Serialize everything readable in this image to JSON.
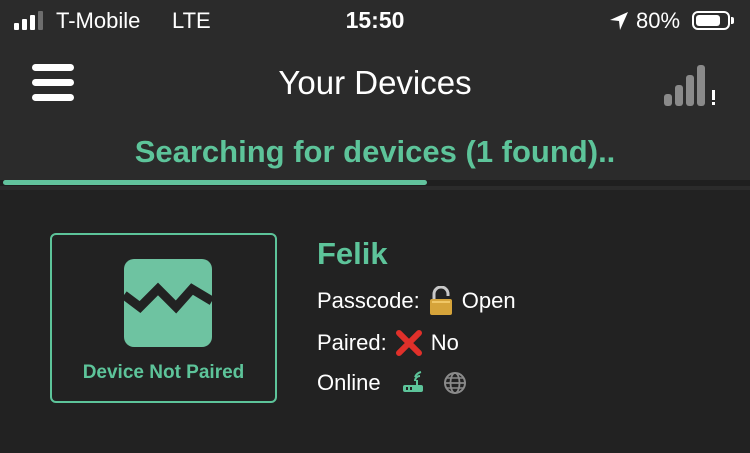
{
  "status_bar": {
    "carrier": "T-Mobile",
    "network": "LTE",
    "time": "15:50",
    "battery_percent": "80%",
    "battery_level": 0.8,
    "signal_bars": 3,
    "signal_bars_total": 4
  },
  "nav": {
    "title": "Your Devices",
    "menu_icon": "hamburger-menu-icon",
    "signal_icon": "signal-warning-icon"
  },
  "search": {
    "status": "Searching for devices (1 found)..",
    "progress": 0.57
  },
  "device": {
    "card_label": "Device Not Paired",
    "name": "Felik",
    "passcode_label": "Passcode:",
    "passcode_value": "Open",
    "passcode_icon": "open-lock-icon",
    "paired_label": "Paired:",
    "paired_value": "No",
    "paired_icon": "cross-mark-icon",
    "online_label": "Online",
    "online_icons": [
      "router-icon",
      "globe-icon"
    ]
  },
  "colors": {
    "accent": "#5dc49a",
    "background": "#222222",
    "header": "#2b2b2b",
    "cross": "#e0302a"
  }
}
